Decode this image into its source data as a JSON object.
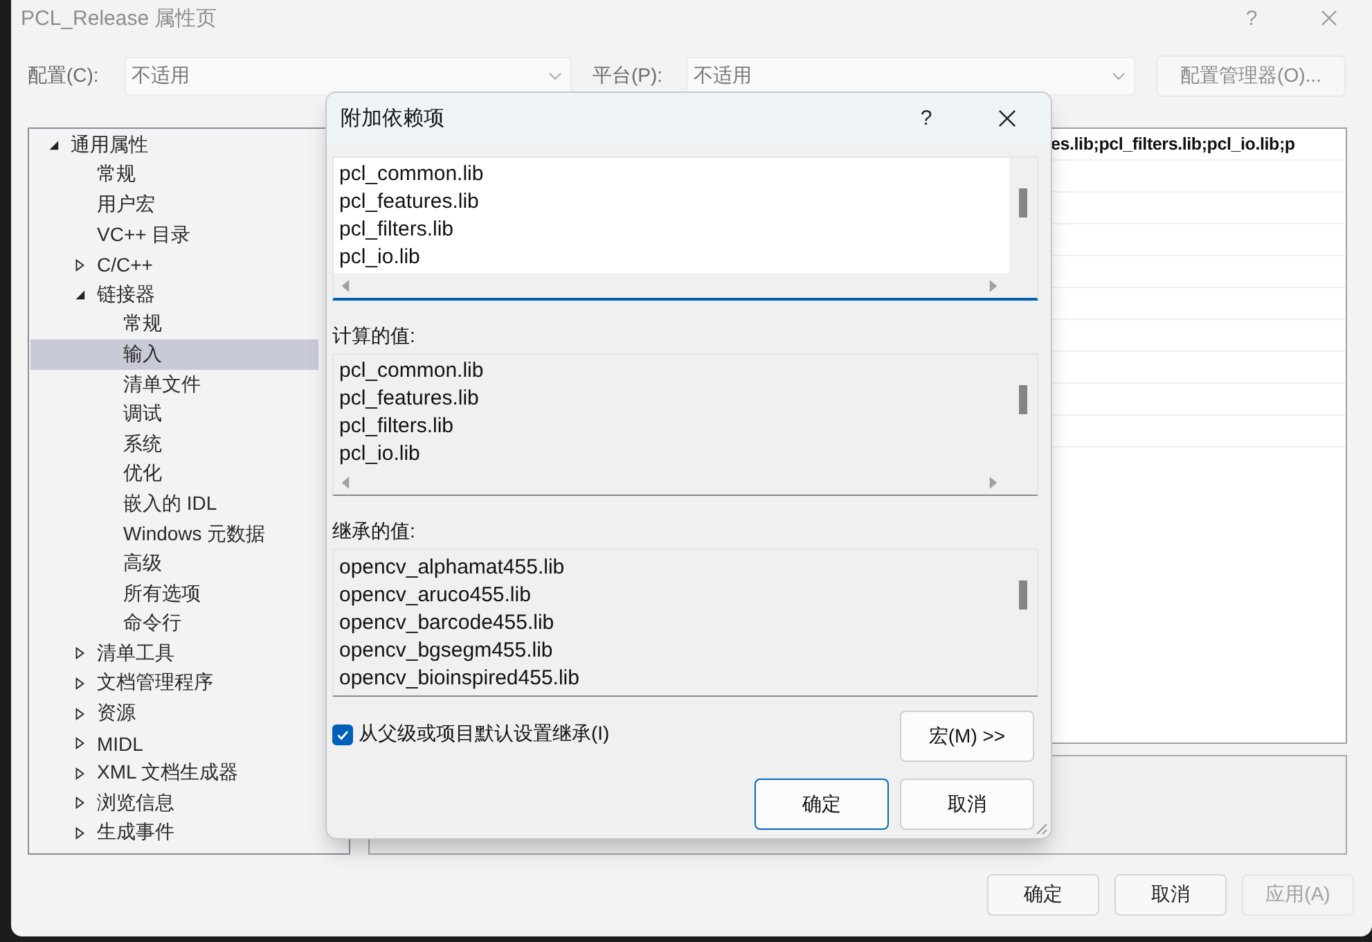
{
  "window": {
    "title": "PCL_Release 属性页",
    "help_label": "?"
  },
  "configuration": {
    "label": "配置(C):",
    "value": "不适用"
  },
  "platform": {
    "label": "平台(P):",
    "value": "不适用"
  },
  "config_manager_button": "配置管理器(O)...",
  "tree": [
    {
      "label": "通用属性",
      "kind": "group",
      "expanded": true,
      "selected": false,
      "children": [
        {
          "label": "常规",
          "kind": "item",
          "selected": false
        },
        {
          "label": "用户宏",
          "kind": "item",
          "selected": false
        },
        {
          "label": "VC++ 目录",
          "kind": "item",
          "selected": false
        },
        {
          "label": "C/C++",
          "kind": "group",
          "expanded": false,
          "selected": false
        },
        {
          "label": "链接器",
          "kind": "group",
          "expanded": true,
          "selected": false,
          "children": [
            {
              "label": "常规",
              "kind": "item",
              "selected": false
            },
            {
              "label": "输入",
              "kind": "item",
              "selected": true
            },
            {
              "label": "清单文件",
              "kind": "item",
              "selected": false
            },
            {
              "label": "调试",
              "kind": "item",
              "selected": false
            },
            {
              "label": "系统",
              "kind": "item",
              "selected": false
            },
            {
              "label": "优化",
              "kind": "item",
              "selected": false
            },
            {
              "label": "嵌入的 IDL",
              "kind": "item",
              "selected": false
            },
            {
              "label": "Windows 元数据",
              "kind": "item",
              "selected": false
            },
            {
              "label": "高级",
              "kind": "item",
              "selected": false
            },
            {
              "label": "所有选项",
              "kind": "item",
              "selected": false
            },
            {
              "label": "命令行",
              "kind": "item",
              "selected": false
            }
          ]
        },
        {
          "label": "清单工具",
          "kind": "group",
          "expanded": false,
          "selected": false
        },
        {
          "label": "文档管理程序",
          "kind": "group",
          "expanded": false,
          "selected": false
        },
        {
          "label": "资源",
          "kind": "group",
          "expanded": false,
          "selected": false
        },
        {
          "label": "MIDL",
          "kind": "group",
          "expanded": false,
          "selected": false
        },
        {
          "label": "XML 文档生成器",
          "kind": "group",
          "expanded": false,
          "selected": false
        },
        {
          "label": "浏览信息",
          "kind": "group",
          "expanded": false,
          "selected": false
        },
        {
          "label": "生成事件",
          "kind": "group",
          "expanded": false,
          "selected": false
        }
      ]
    }
  ],
  "property_grid": {
    "value": "es.lib;pcl_filters.lib;pcl_io.lib;p"
  },
  "buttons": [
    {
      "label": "确定",
      "disabled": false
    },
    {
      "label": "取消",
      "disabled": false
    },
    {
      "label": "应用(A)",
      "disabled": true
    }
  ],
  "dialog": {
    "title": "附加依赖项",
    "help_label": "?",
    "edit_lines": [
      "pcl_common.lib",
      "pcl_features.lib",
      "pcl_filters.lib",
      "pcl_io.lib"
    ],
    "computed_label": "计算的值:",
    "computed_lines": [
      "pcl_common.lib",
      "pcl_features.lib",
      "pcl_filters.lib",
      "pcl_io.lib"
    ],
    "inherited_label": "继承的值:",
    "inherited_lines": [
      "opencv_alphamat455.lib",
      "opencv_aruco455.lib",
      "opencv_barcode455.lib",
      "opencv_bgsegm455.lib",
      "opencv_bioinspired455.lib"
    ],
    "inherit_checkbox": {
      "label": "从父级或项目默认设置继承(I)",
      "checked": true
    },
    "macros_button": "宏(M) >>",
    "buttons": [
      {
        "label": "确定",
        "default": true
      },
      {
        "label": "取消",
        "default": false
      }
    ]
  }
}
